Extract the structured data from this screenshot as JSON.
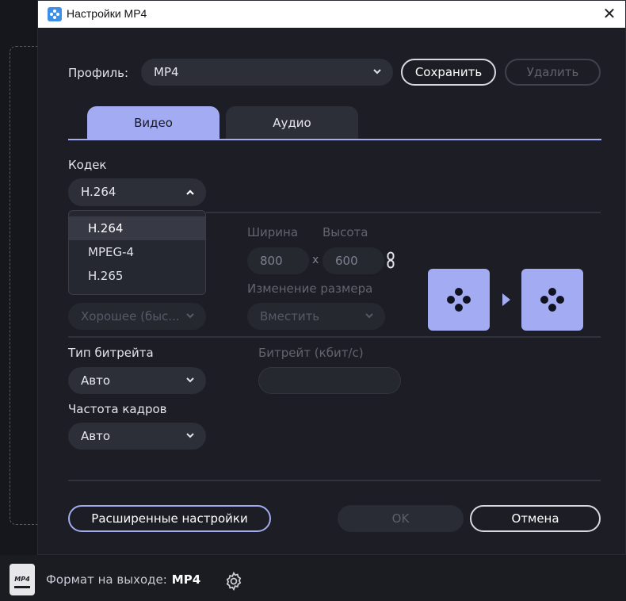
{
  "dialog": {
    "title": "Настройки MP4",
    "close": "✕"
  },
  "profile": {
    "label": "Профиль:",
    "value": "MP4",
    "save": "Сохранить",
    "delete": "Удалить"
  },
  "tabs": [
    {
      "label": "Видео",
      "active": true
    },
    {
      "label": "Аудио",
      "active": false
    }
  ],
  "codec": {
    "label": "Кодек",
    "value": "H.264",
    "options": [
      "H.264",
      "MPEG-4",
      "H.265"
    ],
    "selected_index": 0
  },
  "frame_size": {
    "width_label": "Ширина",
    "height_label": "Высота",
    "width": "800",
    "height": "600",
    "separator": "x"
  },
  "resize": {
    "label": "Изменение размера",
    "value": "Вместить"
  },
  "quality": {
    "value": "Хорошее (быс..."
  },
  "bitrate_type": {
    "label": "Тип битрейта",
    "value": "Авто"
  },
  "bitrate": {
    "label": "Битрейт (кбит/с)",
    "value": ""
  },
  "frame_rate": {
    "label": "Частота кадров",
    "value": "Авто"
  },
  "footer": {
    "advanced": "Расширенные настройки",
    "ok": "OK",
    "cancel": "Отмена"
  },
  "bottom_bar": {
    "format_label": "Формат на выходе:",
    "format_value": "MP4",
    "format_icon_text": "MP4"
  },
  "colors": {
    "accent": "#a3acf2",
    "dialog_bg": "#1d1e25",
    "control_bg": "#2c2e38"
  },
  "icons": {
    "app": "movavi-logo-icon",
    "close": "close-icon",
    "chevron_down": "chevron-down-icon",
    "chevron_up": "chevron-up-icon",
    "link": "chain-link-icon",
    "gear": "gear-icon",
    "format": "mp4-file-icon"
  }
}
